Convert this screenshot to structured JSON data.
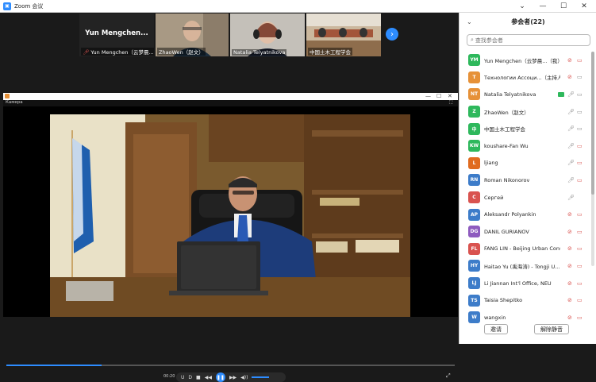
{
  "window": {
    "title": "Zoom 会议",
    "controls": [
      "⌄",
      "—",
      "☐",
      "✕"
    ]
  },
  "thumbnails": [
    {
      "id": "yun",
      "name": "Yun Mengchen（云梦晨...",
      "big_label": "Yun Mengchen...",
      "muted": true,
      "bg": "#232323"
    },
    {
      "id": "zhao",
      "name": "ZhaoWen（赵文）",
      "big_label": "",
      "muted": false,
      "bg": "#9e8f7c"
    },
    {
      "id": "natalia",
      "name": "Natalia Telyatnikova",
      "big_label": "",
      "muted": false,
      "bg": "#b8b4ae"
    },
    {
      "id": "ccsce",
      "name": "中国土木工程学会",
      "big_label": "",
      "muted": false,
      "bg": "#c9b59c"
    }
  ],
  "player": {
    "label": "Камера",
    "timestamp": "00:20",
    "controls": [
      "U",
      "D",
      "■",
      "◀◀",
      "▶▶",
      "◀))"
    ],
    "play_icon": "❚❚",
    "exit_icon": "⤢"
  },
  "panel": {
    "title": "参会者(22)",
    "search_placeholder": "查找参会者",
    "participants": [
      {
        "initials": "YM",
        "color": "#2eb85c",
        "name": "Yun Mengchen（云梦晨...（我）",
        "mic": "muted",
        "cam": "off",
        "sharing": false
      },
      {
        "initials": "T",
        "color": "#e69138",
        "name": "Технологии Ассоци...（主持人）",
        "mic": "muted",
        "cam": "on",
        "sharing": false
      },
      {
        "initials": "NT",
        "color": "#e69138",
        "name": "Natalia Telyatnikova",
        "mic": "on",
        "cam": "on",
        "sharing": true
      },
      {
        "initials": "Z",
        "color": "#2eb85c",
        "name": "ZhaoWen（赵文）",
        "mic": "on",
        "cam": "on",
        "sharing": false
      },
      {
        "initials": "中",
        "color": "#2eb85c",
        "name": "中国土木工程学会",
        "mic": "on",
        "cam": "on",
        "sharing": false
      },
      {
        "initials": "KW",
        "color": "#2eb85c",
        "name": "koushare-Fan Wu",
        "mic": "on",
        "cam": "off",
        "sharing": false
      },
      {
        "initials": "L",
        "color": "#e06b1f",
        "name": "ljiang",
        "mic": "on",
        "cam": "off",
        "sharing": false
      },
      {
        "initials": "RN",
        "color": "#3d7cc9",
        "name": "Roman Nikonorov",
        "mic": "on",
        "cam": "off",
        "sharing": false
      },
      {
        "initials": "C",
        "color": "#d9534f",
        "name": "Сергей",
        "mic": "on",
        "cam": "",
        "sharing": false
      },
      {
        "initials": "AP",
        "color": "#3d7cc9",
        "name": "Aleksandr Polyankin",
        "mic": "muted",
        "cam": "off",
        "sharing": false
      },
      {
        "initials": "DG",
        "color": "#8e5bbf",
        "name": "DANIL GURIANOV",
        "mic": "muted",
        "cam": "off",
        "sharing": false
      },
      {
        "initials": "FL",
        "color": "#d9534f",
        "name": "FANG LIN - Beijing Urban Cons...",
        "mic": "muted",
        "cam": "off",
        "sharing": false
      },
      {
        "initials": "HY",
        "color": "#3d7cc9",
        "name": "Haitao Yu (禹海涛) - Tongji U...",
        "mic": "muted",
        "cam": "off",
        "sharing": false
      },
      {
        "initials": "LJ",
        "color": "#3d7cc9",
        "name": "Li Jiannan Int'l Office, NEU",
        "mic": "muted",
        "cam": "off",
        "sharing": false
      },
      {
        "initials": "TS",
        "color": "#3d7cc9",
        "name": "Taisia Shepitko",
        "mic": "muted",
        "cam": "off",
        "sharing": false
      },
      {
        "initials": "W",
        "color": "#3d7cc9",
        "name": "wangxin",
        "mic": "muted",
        "cam": "off",
        "sharing": false
      }
    ],
    "invite_label": "邀请",
    "unmute_label": "解除静音"
  }
}
